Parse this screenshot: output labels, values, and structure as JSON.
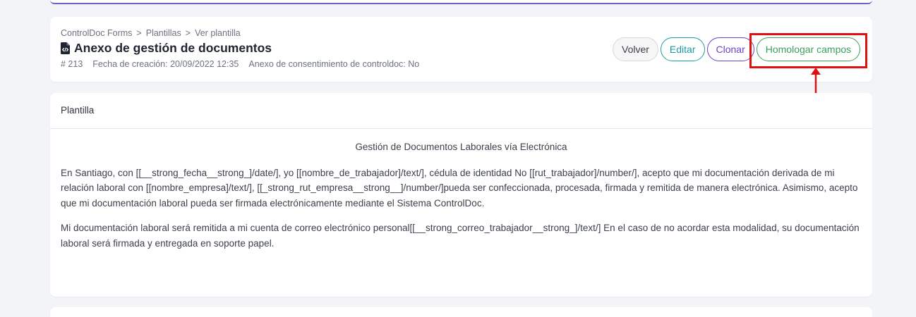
{
  "breadcrumb": {
    "items": [
      "ControlDoc Forms",
      "Plantillas",
      "Ver plantilla"
    ],
    "separator": ">"
  },
  "template": {
    "title": "Anexo de gestión de documentos",
    "number": "# 213",
    "created": "Fecha de creación: 20/09/2022 12:35",
    "consent": "Anexo de consentimiento de controldoc: No"
  },
  "actions": {
    "volver": "Volver",
    "editar": "Editar",
    "clonar": "Clonar",
    "homologar": "Homologar campos"
  },
  "panel": {
    "header": "Plantilla",
    "heading": "Gestión de Documentos Laborales vía Electrónica",
    "paragraph1": "En Santiago, con [[__strong_fecha__strong_]/date/], yo [[nombre_de_trabajador]/text/], cédula de identidad No [[rut_trabajador]/number/], acepto que mi documentación derivada de mi relación laboral con [[nombre_empresa]/text/], [[_strong_rut_empresa__strong__]/number/]pueda ser confeccionada, procesada, firmada y remitida de manera electrónica. Asimismo, acepto que mi documentación laboral pueda ser firmada electrónicamente mediante el Sistema ControlDoc.",
    "paragraph2": "Mi documentación laboral será remitida a mi cuenta de correo electrónico personal[[__strong_correo_trabajador__strong_]/text/] En el caso de no acordar esta modalidad, su documentación laboral será firmada y entregada en soporte papel."
  },
  "colors": {
    "editar": "#1a9aa0",
    "clonar": "#6b41c7",
    "homologar": "#3aa05a",
    "highlight": "#e01010"
  },
  "icons": [
    "file-code-icon",
    "red-arrow-annotation"
  ]
}
